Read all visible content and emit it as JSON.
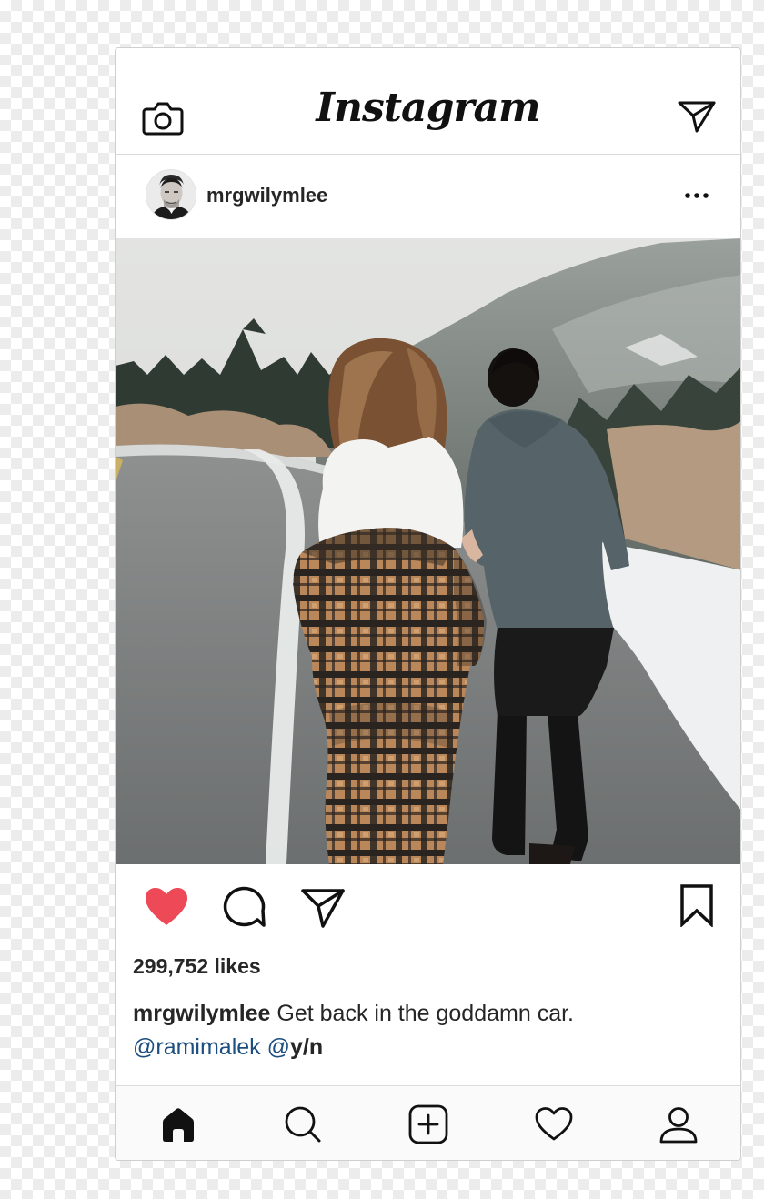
{
  "app": {
    "wordmark": "Instagram",
    "top_icons": [
      "camera-icon",
      "direct-message-icon"
    ]
  },
  "post": {
    "username": "mrgwilymlee",
    "avatar_icon": "profile-photo-avatar",
    "more_icon": "more-options-icon",
    "image_description": "couple-walking-on-snowy-mountain-road",
    "actions": {
      "like_icon": "heart-filled-icon",
      "comment_icon": "comment-bubble-icon",
      "share_icon": "paper-plane-icon",
      "save_icon": "bookmark-icon",
      "like_color": "#ed4956"
    },
    "likes_text": "299,752 likes",
    "caption": {
      "username": "mrgwilymlee",
      "text": " Get back in the goddamn car.",
      "mention_1": "@ramimalek",
      "mention_2_prefix": "@",
      "mention_2_suffix": "y/n"
    }
  },
  "bottom_nav": [
    "home-icon",
    "search-icon",
    "add-post-icon",
    "activity-heart-icon",
    "profile-icon"
  ],
  "colors": {
    "text": "#262626",
    "mention": "#1d4e80",
    "border": "#dbdbdb"
  }
}
